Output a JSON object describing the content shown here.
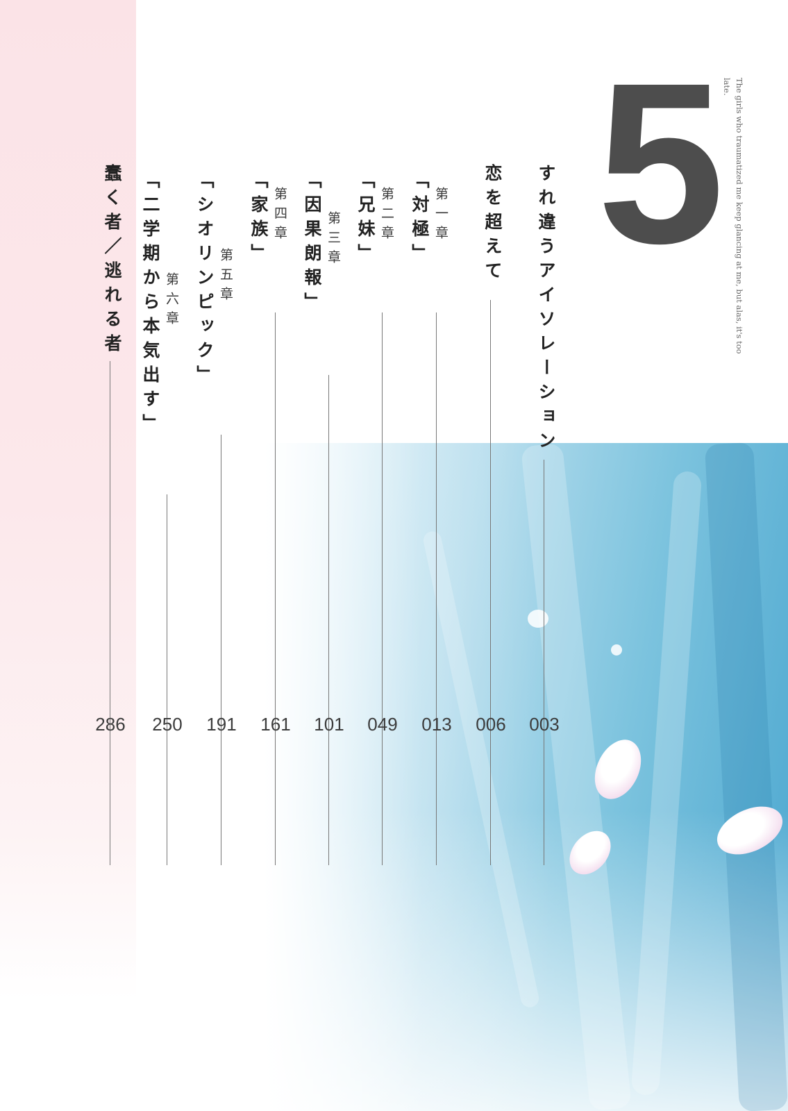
{
  "volume": "5",
  "english_title": "The girls who traumatized me keep glancing at me, but alas, it's too late.",
  "toc": [
    {
      "chapter": "",
      "title": "すれ違うアイソレーション",
      "page": "003"
    },
    {
      "chapter": "",
      "title": "恋を超えて",
      "page": "006"
    },
    {
      "chapter": "第一章",
      "title": "「対極」",
      "page": "013"
    },
    {
      "chapter": "第二章",
      "title": "「兄妹」",
      "page": "049"
    },
    {
      "chapter": "第三章",
      "title": "「因果朗報」",
      "page": "101"
    },
    {
      "chapter": "第四章",
      "title": "「家族」",
      "page": "161"
    },
    {
      "chapter": "第五章",
      "title": "「シオリンピック」",
      "page": "191"
    },
    {
      "chapter": "第六章",
      "title": "「二学期から本気出す」",
      "page": "250"
    },
    {
      "chapter": "",
      "title": "蠢く者／逃れる者",
      "page": "286"
    }
  ]
}
